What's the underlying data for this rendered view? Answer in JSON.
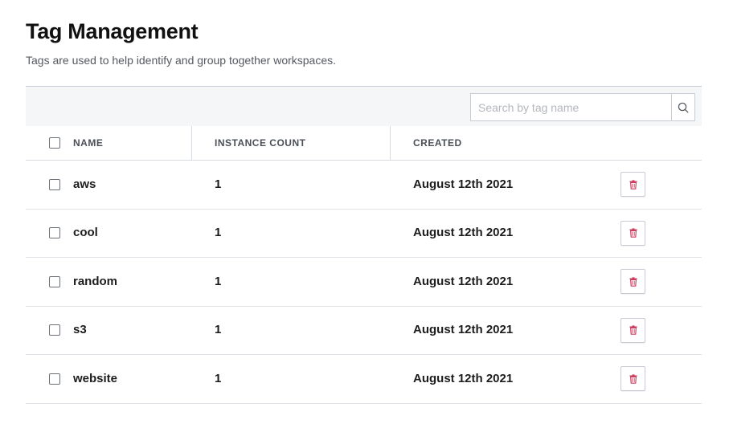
{
  "page": {
    "title": "Tag Management",
    "subtitle": "Tags are used to help identify and group together workspaces."
  },
  "search": {
    "placeholder": "Search by tag name",
    "value": "",
    "icon": "search-icon"
  },
  "table": {
    "columns": {
      "name": "NAME",
      "instance_count": "INSTANCE COUNT",
      "created": "CREATED"
    },
    "rows": [
      {
        "name": "aws",
        "instance_count": "1",
        "created": "August 12th 2021"
      },
      {
        "name": "cool",
        "instance_count": "1",
        "created": "August 12th 2021"
      },
      {
        "name": "random",
        "instance_count": "1",
        "created": "August 12th 2021"
      },
      {
        "name": "s3",
        "instance_count": "1",
        "created": "August 12th 2021"
      },
      {
        "name": "website",
        "instance_count": "1",
        "created": "August 12th 2021"
      }
    ],
    "row_action_icon": "trash-icon"
  },
  "colors": {
    "delete_icon": "#c8385a",
    "toolbar_bg": "#f5f6f8",
    "border": "#c8ccd2"
  }
}
